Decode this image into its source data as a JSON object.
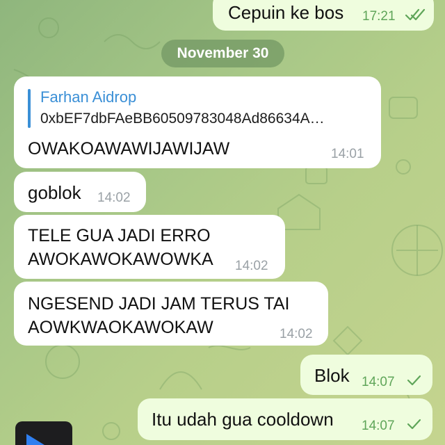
{
  "chat": {
    "date_separator": "November 30",
    "messages": [
      {
        "direction": "out",
        "text": "Cepuin ke bos",
        "time": "17:21",
        "status": "read"
      },
      {
        "direction": "in",
        "reply_to": {
          "name": "Farhan Aidrop",
          "text": "0xbEF7dbFAeBB60509783048Ad86634A…"
        },
        "text": "OWAKOAWAWIJAWIJAW",
        "time": "14:01"
      },
      {
        "direction": "in",
        "text": "goblok",
        "time": "14:02"
      },
      {
        "direction": "in",
        "lines": [
          "TELE GUA JADI ERRO",
          "AWOKAWOKAWOWKA"
        ],
        "time": "14:02"
      },
      {
        "direction": "in",
        "lines": [
          "NGESEND JADI JAM TERUS TAI",
          "AOWKWAOKAWOKAW"
        ],
        "time": "14:02"
      },
      {
        "direction": "out",
        "text": "Blok",
        "time": "14:07",
        "status": "sent"
      },
      {
        "direction": "out",
        "text": "Itu udah gua cooldown",
        "time": "14:07",
        "status": "sent"
      }
    ]
  },
  "colors": {
    "incoming_bubble": "#ffffff",
    "outgoing_bubble": "#effdde",
    "reply_accent": "#3a8fd6",
    "outgoing_time": "#5fa559",
    "incoming_time": "#9aa1a6"
  },
  "icons": {
    "read_status": "double-check-icon",
    "sent_status": "single-check-icon",
    "media": "play-icon"
  }
}
